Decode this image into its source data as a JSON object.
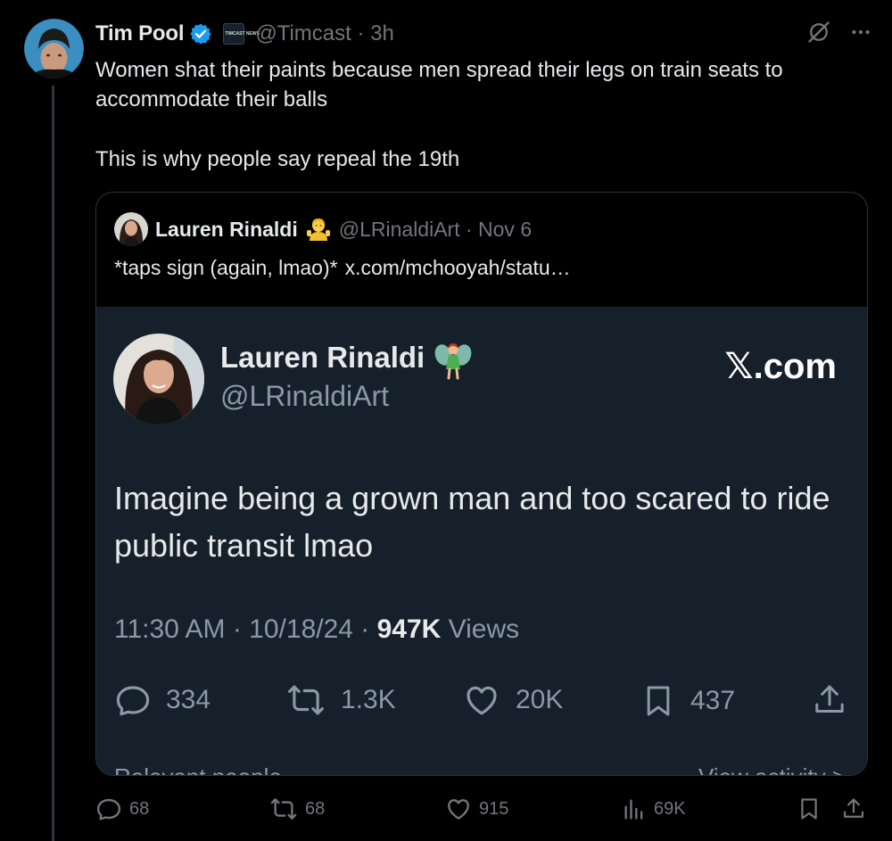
{
  "tweet": {
    "author_name": "Tim Pool",
    "affiliation_badge": "TIMCAST NEWS",
    "handle_time": "@Timcast · 3h",
    "text_line1": "Women shat their paints because men spread their legs on train seats to accommodate their balls",
    "text_line2": "This is why people say repeal the 19th",
    "stats": {
      "replies": "68",
      "reposts": "68",
      "likes": "915",
      "views": "69K"
    }
  },
  "quote": {
    "author_name": "Lauren Rinaldi",
    "handle_time": "@LRinaldiArt · Nov 6",
    "text": "*taps sign (again, lmao)*",
    "link": "x.com/mchooyah/statu…"
  },
  "screenshot": {
    "name": "Lauren Rinaldi",
    "handle": "@LRinaldiArt",
    "brand": "𝕏.com",
    "text": "Imagine being a grown man and too scared to ride public transit lmao",
    "time": "11:30 AM · 10/18/24 · ",
    "views_count": "947K",
    "views_label": " Views",
    "replies": "334",
    "reposts": "1.3K",
    "likes": "20K",
    "bookmarks": "437",
    "cut_left": "Relevant people",
    "cut_right": "View activity >"
  },
  "colors": {
    "background": "#000000",
    "embed_background": "#15202b",
    "muted": "#71767b",
    "verified": "#1d9bf0",
    "text": "#e7e9ea"
  },
  "icons": [
    "verified-badge-icon",
    "grok-icon",
    "more-icon",
    "reply-icon",
    "repost-icon",
    "like-icon",
    "views-icon",
    "bookmark-icon",
    "share-icon"
  ]
}
